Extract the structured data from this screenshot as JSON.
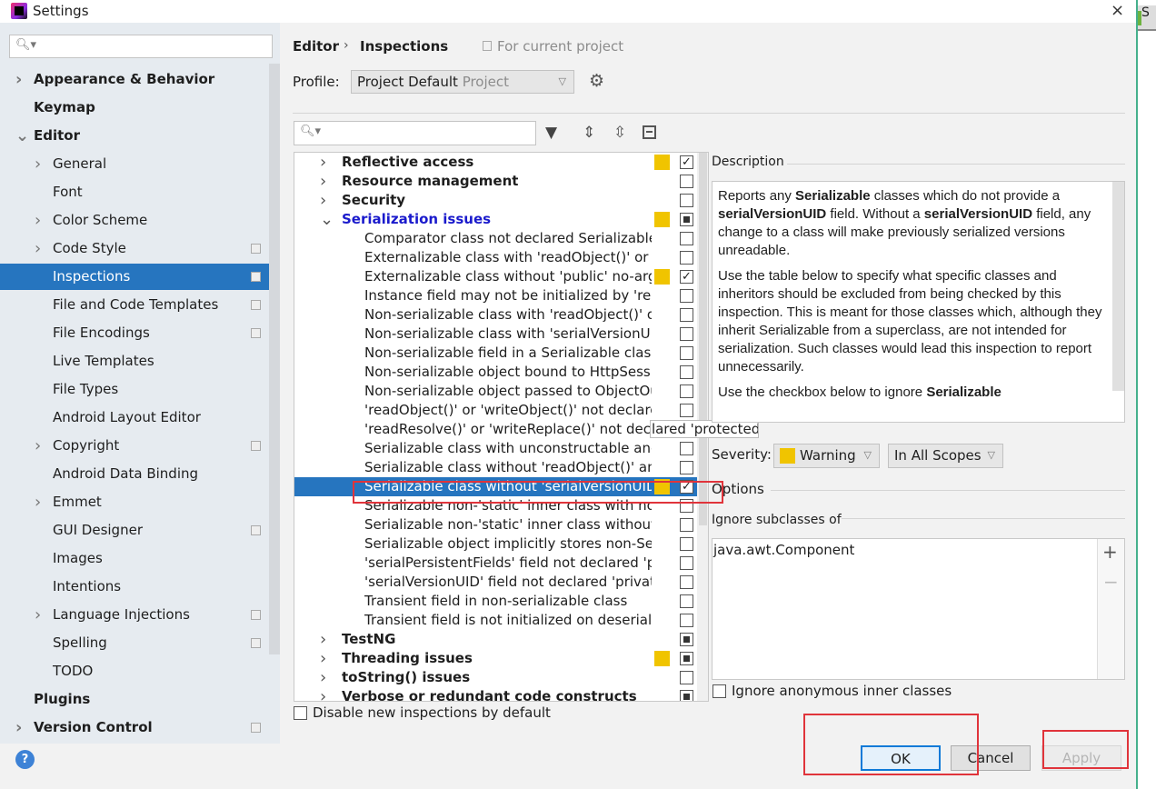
{
  "window": {
    "title": "Settings",
    "close": "×"
  },
  "background_app": {
    "tab_text": "S"
  },
  "sidebar": {
    "search_placeholder": "",
    "items": [
      {
        "label": "Appearance & Behavior",
        "bold": true,
        "chevron": "right",
        "level": 0
      },
      {
        "label": "Keymap",
        "bold": true,
        "level": 0
      },
      {
        "label": "Editor",
        "bold": true,
        "chevron": "down",
        "level": 0
      },
      {
        "label": "General",
        "chevron": "right",
        "level": 1
      },
      {
        "label": "Font",
        "level": 1
      },
      {
        "label": "Color Scheme",
        "chevron": "right",
        "level": 1
      },
      {
        "label": "Code Style",
        "chevron": "right",
        "level": 1,
        "project": true
      },
      {
        "label": "Inspections",
        "level": 1,
        "project": true,
        "selected": true
      },
      {
        "label": "File and Code Templates",
        "level": 1,
        "project": true
      },
      {
        "label": "File Encodings",
        "level": 1,
        "project": true
      },
      {
        "label": "Live Templates",
        "level": 1
      },
      {
        "label": "File Types",
        "level": 1
      },
      {
        "label": "Android Layout Editor",
        "level": 1
      },
      {
        "label": "Copyright",
        "chevron": "right",
        "level": 1,
        "project": true
      },
      {
        "label": "Android Data Binding",
        "level": 1
      },
      {
        "label": "Emmet",
        "chevron": "right",
        "level": 1
      },
      {
        "label": "GUI Designer",
        "level": 1,
        "project": true
      },
      {
        "label": "Images",
        "level": 1
      },
      {
        "label": "Intentions",
        "level": 1
      },
      {
        "label": "Language Injections",
        "chevron": "right",
        "level": 1,
        "project": true
      },
      {
        "label": "Spelling",
        "level": 1,
        "project": true
      },
      {
        "label": "TODO",
        "level": 1
      },
      {
        "label": "Plugins",
        "bold": true,
        "level": 0
      },
      {
        "label": "Version Control",
        "bold": true,
        "chevron": "right",
        "level": 0,
        "project": true
      }
    ]
  },
  "header": {
    "breadcrumb_parent": "Editor",
    "breadcrumb_sep": "›",
    "breadcrumb_current": "Inspections",
    "scope_note": "For current project"
  },
  "profile": {
    "label": "Profile:",
    "value": "Project Default",
    "value_hint": "Project"
  },
  "tree": {
    "search_placeholder": "",
    "rows": [
      {
        "name": "Reflective access",
        "type": "cat",
        "chevron": "›",
        "warn": true,
        "check": "checked"
      },
      {
        "name": "Resource management",
        "type": "cat",
        "chevron": "›",
        "warn": false,
        "check": "unchecked"
      },
      {
        "name": "Security",
        "type": "cat",
        "chevron": "›",
        "warn": false,
        "check": "unchecked"
      },
      {
        "name": "Serialization issues",
        "type": "cat",
        "chevron": "⌄",
        "warn": true,
        "check": "mixed",
        "highlight": true
      },
      {
        "name": "Comparator class not declared Serializable",
        "type": "child",
        "warn": false,
        "check": "unchecked"
      },
      {
        "name": "Externalizable class with 'readObject()' or 'writeObject()'",
        "type": "child",
        "warn": false,
        "check": "unchecked"
      },
      {
        "name": "Externalizable class without 'public' no-arg constructor",
        "type": "child",
        "warn": true,
        "check": "checked"
      },
      {
        "name": "Instance field may not be initialized by 'readObject()'",
        "type": "child",
        "warn": false,
        "check": "unchecked"
      },
      {
        "name": "Non-serializable class with 'readObject()' or 'writeObject()'",
        "type": "child",
        "warn": false,
        "check": "unchecked"
      },
      {
        "name": "Non-serializable class with 'serialVersionUID'",
        "type": "child",
        "warn": false,
        "check": "unchecked"
      },
      {
        "name": "Non-serializable field in a Serializable class",
        "type": "child",
        "warn": false,
        "check": "unchecked"
      },
      {
        "name": "Non-serializable object bound to HttpSession",
        "type": "child",
        "warn": false,
        "check": "unchecked"
      },
      {
        "name": "Non-serializable object passed to ObjectOutputStream",
        "type": "child",
        "warn": false,
        "check": "unchecked"
      },
      {
        "name": "'readObject()' or 'writeObject()' not declared 'private'",
        "type": "child",
        "warn": false,
        "check": "unchecked"
      },
      {
        "name": "'readResolve()' or 'writeReplace()' not declared 'protected'",
        "type": "child",
        "warn": false,
        "check": "unchecked"
      },
      {
        "name": "Serializable class with unconstructable ancestor",
        "type": "child",
        "warn": false,
        "check": "unchecked"
      },
      {
        "name": "Serializable class without 'readObject()' and 'writeObject()'",
        "type": "child",
        "warn": false,
        "check": "unchecked"
      },
      {
        "name": "Serializable class without 'serialVersionUID'",
        "type": "child",
        "warn": true,
        "check": "checked",
        "selected": true
      },
      {
        "name": "Serializable non-'static' inner class with non-Serializable outer class",
        "type": "child",
        "warn": false,
        "check": "unchecked"
      },
      {
        "name": "Serializable non-'static' inner class without 'serialVersionUID'",
        "type": "child",
        "warn": false,
        "check": "unchecked"
      },
      {
        "name": "Serializable object implicitly stores non-Serializable object",
        "type": "child",
        "warn": false,
        "check": "unchecked"
      },
      {
        "name": "'serialPersistentFields' field not declared 'private static final'",
        "type": "child",
        "warn": false,
        "check": "unchecked"
      },
      {
        "name": "'serialVersionUID' field not declared 'private static final long'",
        "type": "child",
        "warn": false,
        "check": "unchecked"
      },
      {
        "name": "Transient field in non-serializable class",
        "type": "child",
        "warn": false,
        "check": "unchecked"
      },
      {
        "name": "Transient field is not initialized on deserialization",
        "type": "child",
        "warn": false,
        "check": "unchecked"
      },
      {
        "name": "TestNG",
        "type": "cat",
        "chevron": "›",
        "warn": false,
        "check": "mixed"
      },
      {
        "name": "Threading issues",
        "type": "cat",
        "chevron": "›",
        "warn": true,
        "check": "mixed"
      },
      {
        "name": "toString() issues",
        "type": "cat",
        "chevron": "›",
        "warn": false,
        "check": "unchecked"
      },
      {
        "name": "Verbose or redundant code constructs",
        "type": "cat",
        "chevron": "›",
        "warn": false,
        "check": "mixed"
      }
    ],
    "tooltip": "'readResolve()' or 'writeReplace()' not declared 'protected'",
    "disable_new_label": "Disable new inspections by default"
  },
  "description": {
    "label": "Description",
    "p1": [
      "Reports any ",
      "Serializable",
      " classes which do not provide a ",
      "serialVersionUID",
      " field. Without a ",
      "serialVersionUID",
      " field, any change to a class will make previously serialized versions unreadable."
    ],
    "p2": "Use the table below to specify what specific classes and inheritors should be excluded from being checked by this inspection. This is meant for those classes which, although they inherit Serializable from a superclass, are not intended for serialization. Such classes would lead this inspection to report unnecessarily.",
    "p3": [
      "Use the checkbox below to ignore ",
      "Serializable"
    ]
  },
  "severity": {
    "label": "Severity:",
    "value": "Warning",
    "color": "#f0c400",
    "scope": "In All Scopes"
  },
  "options": {
    "label": "Options",
    "ignore_subclasses_label": "Ignore subclasses of",
    "list": [
      "java.awt.Component"
    ],
    "add": "+",
    "remove": "−",
    "ignore_anonymous_label": "Ignore anonymous inner classes"
  },
  "footer": {
    "help": "?",
    "ok": "OK",
    "cancel": "Cancel",
    "apply": "Apply"
  },
  "colors": {
    "selection": "#2675bf",
    "warning": "#f0c400",
    "annotation_red": "#e0343b"
  }
}
